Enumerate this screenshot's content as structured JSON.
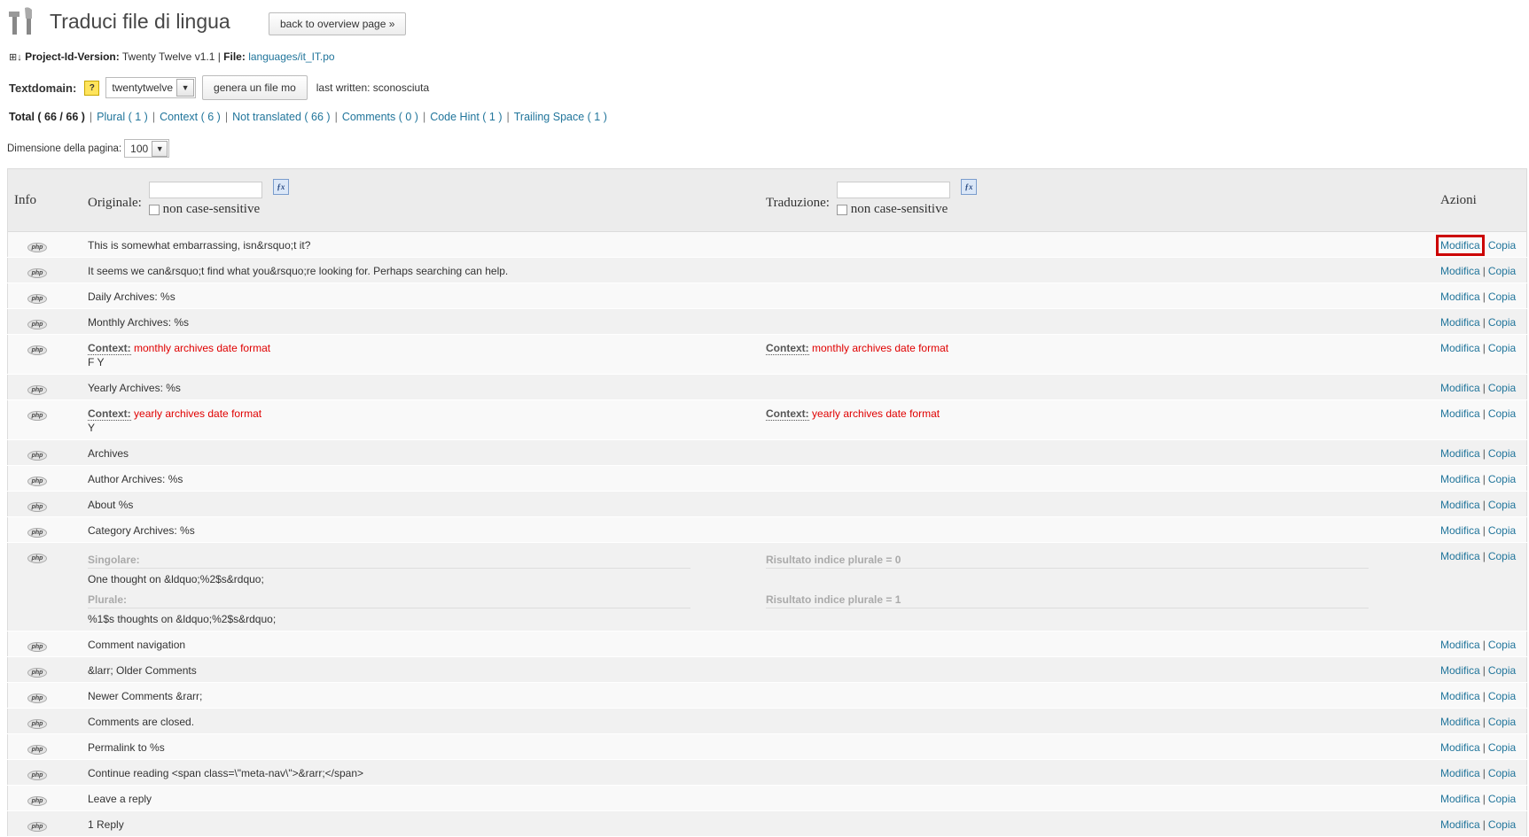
{
  "header": {
    "title": "Traduci file di lingua",
    "back_button": "back to overview page »"
  },
  "project": {
    "label": "Project-Id-Version:",
    "version": "Twenty Twelve v1.1",
    "file_label": "File:",
    "file": "languages/it_IT.po"
  },
  "textdomain": {
    "label": "Textdomain:",
    "help": "?",
    "value": "twentytwelve",
    "generate_button": "genera un file mo",
    "last_written_label": "last written:",
    "last_written_value": "sconosciuta"
  },
  "filters": {
    "total": "Total ( 66 / 66 )",
    "plural": "Plural ( 1 )",
    "context": "Context ( 6 )",
    "not_translated": "Not translated ( 66 )",
    "comments": "Comments ( 0 )",
    "code_hint": "Code Hint ( 1 )",
    "trailing_space": "Trailing Space ( 1 )"
  },
  "page_size": {
    "label": "Dimensione della pagina:",
    "value": "100"
  },
  "table": {
    "col_info": "Info",
    "col_original": "Originale:",
    "col_translation": "Traduzione:",
    "col_actions": "Azioni",
    "case_label": "non case-sensitive",
    "edit_label": "Modifica",
    "copy_label": "Copia",
    "rows": [
      {
        "original": "This is somewhat embarrassing, isn&rsquo;t it?"
      },
      {
        "original": "It seems we can&rsquo;t find what you&rsquo;re looking for. Perhaps searching can help."
      },
      {
        "original": "Daily Archives: %s"
      },
      {
        "original": "Monthly Archives: %s"
      },
      {
        "context_label": "Context:",
        "context": "monthly archives date format",
        "original": "F Y"
      },
      {
        "original": "Yearly Archives: %s"
      },
      {
        "context_label": "Context:",
        "context": "yearly archives date format",
        "original": "Y"
      },
      {
        "original": "Archives"
      },
      {
        "original": "Author Archives: %s"
      },
      {
        "original": "About %s"
      },
      {
        "original": "Category Archives: %s"
      },
      {
        "singular_label": "Singolare:",
        "singular": "One thought on &ldquo;%2$s&rdquo;",
        "plural_label": "Plurale:",
        "plural": "%1$s thoughts on &ldquo;%2$s&rdquo;",
        "result0": "Risultato indice plurale = 0",
        "result1": "Risultato indice plurale = 1"
      },
      {
        "original": "Comment navigation"
      },
      {
        "original": "&larr; Older Comments"
      },
      {
        "original": "Newer Comments &rarr;"
      },
      {
        "original": "Comments are closed."
      },
      {
        "original": "Permalink to %s"
      },
      {
        "original": "Continue reading <span class=\\\"meta-nav\\\">&rarr;</span>"
      },
      {
        "original": "Leave a reply"
      },
      {
        "original": "1 Reply"
      }
    ]
  },
  "icons": {
    "page": "tools-icon",
    "row": "php-icon",
    "filter": "fx-icon"
  }
}
